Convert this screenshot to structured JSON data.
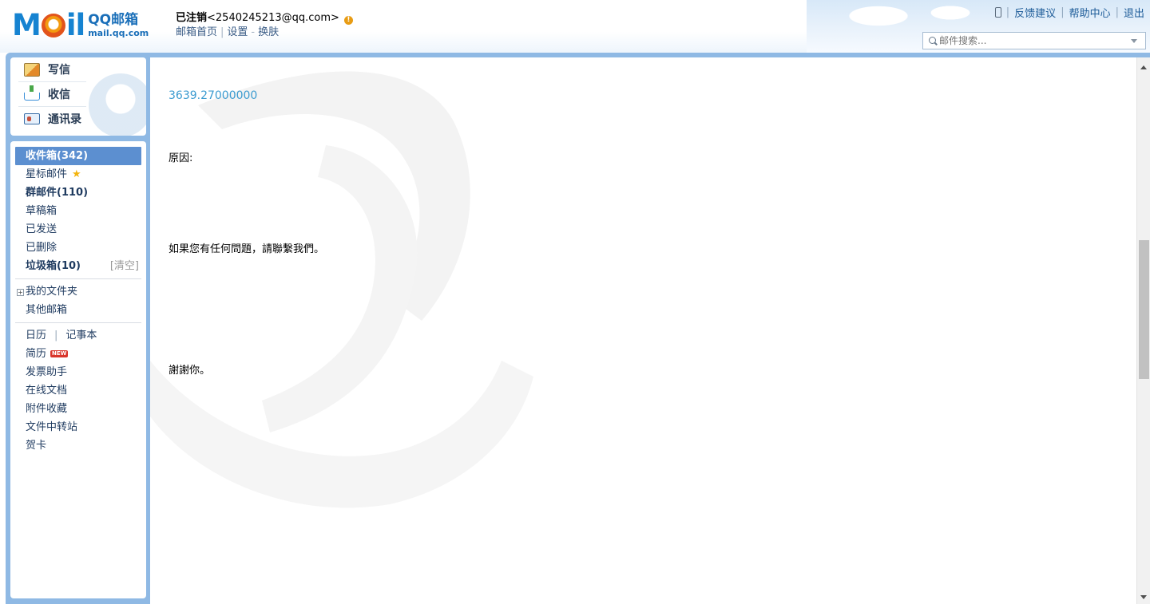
{
  "brand": {
    "logo_text": "Mail",
    "name": "QQ邮箱",
    "domain": "mail.qq.com"
  },
  "account": {
    "display_name": "已注销",
    "email": "<2540245213@qq.com>",
    "links": [
      "邮箱首页",
      "设置",
      "换肤"
    ]
  },
  "top_links": [
    "反馈建议",
    "帮助中心",
    "退出"
  ],
  "search": {
    "placeholder": "邮件搜索..."
  },
  "quick_actions": [
    "写信",
    "收信",
    "通讯录"
  ],
  "folders": {
    "inbox": "收件箱(342)",
    "starred": "星标邮件",
    "group": "群邮件(110)",
    "drafts": "草稿箱",
    "sent": "已发送",
    "deleted": "已删除",
    "spam": "垃圾箱(10)",
    "spam_clean": "[清空]",
    "my_folders": "我的文件夹",
    "other_mailbox": "其他邮箱"
  },
  "apps": {
    "calendar": "日历",
    "notes": "记事本",
    "resume": "简历",
    "resume_badge": "NEW",
    "invoice": "发票助手",
    "docs": "在线文档",
    "attachments": "附件收藏",
    "transfer": "文件中转站",
    "cards": "贺卡"
  },
  "mail_body": {
    "amount": "3639.27000000",
    "reason_label": "原因:",
    "contact_text": "如果您有任何問題，請聯繫我們。",
    "thanks": "謝謝你。"
  },
  "colors": {
    "frame_blue": "#8fb9e4",
    "active_item": "#5c8fd0",
    "link_blue": "#1f5d99",
    "amount_blue": "#3b9bd0"
  }
}
